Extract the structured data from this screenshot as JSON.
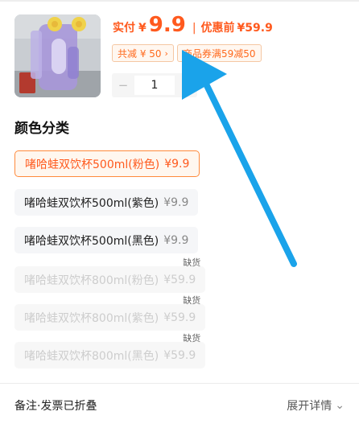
{
  "price": {
    "actual_label": "实付",
    "currency": "¥",
    "actual_value": "9.9",
    "separator": "|",
    "original_label": "优惠前",
    "original_value": "¥59.9"
  },
  "coupons": {
    "total_discount": "共减 ¥ 50",
    "total_discount_chevron": "›",
    "store_coupon": "商品券满59减50"
  },
  "quantity": {
    "minus": "−",
    "value": "1",
    "plus": "+"
  },
  "section_title": "颜色分类",
  "options": [
    {
      "name": "啫哈蛙双饮杯500ml(粉色)",
      "price": "¥9.9",
      "state": "selected",
      "badge": ""
    },
    {
      "name": "啫哈蛙双饮杯500ml(紫色)",
      "price": "¥9.9",
      "state": "available",
      "badge": ""
    },
    {
      "name": "啫哈蛙双饮杯500ml(黑色)",
      "price": "¥9.9",
      "state": "available",
      "badge": ""
    },
    {
      "name": "啫哈蛙双饮杯800ml(粉色)",
      "price": "¥59.9",
      "state": "soldout",
      "badge": "缺货"
    },
    {
      "name": "啫哈蛙双饮杯800ml(紫色)",
      "price": "¥59.9",
      "state": "soldout",
      "badge": "缺货"
    },
    {
      "name": "啫哈蛙双饮杯800ml(黑色)",
      "price": "¥59.9",
      "state": "soldout",
      "badge": "缺货"
    }
  ],
  "footer": {
    "remark": "备注·发票已折叠",
    "expand": "展开详情",
    "expand_chevron": "⌄"
  },
  "colors": {
    "accent": "#ff5a1e",
    "selected_border": "#ff8a3c",
    "annotation_arrow": "#1aa3ea"
  }
}
